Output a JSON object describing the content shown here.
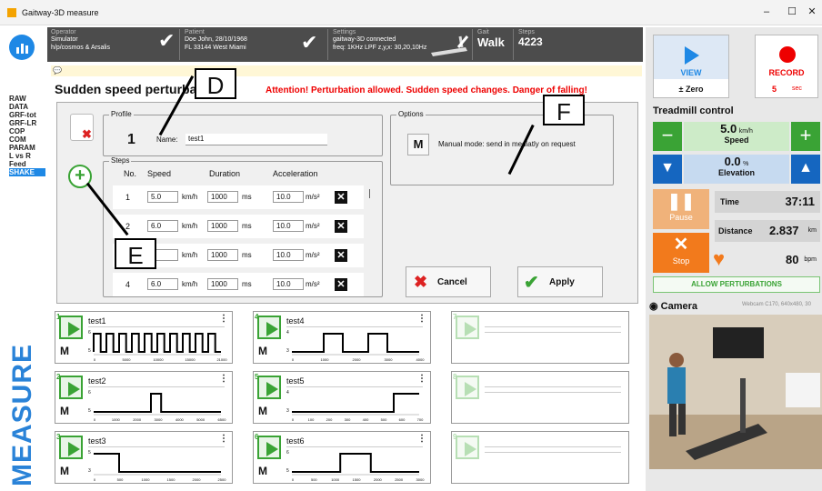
{
  "window": {
    "title": "Gaitway-3D measure",
    "min": "–",
    "max": "☐",
    "close": "✕"
  },
  "infobar": {
    "operator": {
      "label": "Operator",
      "line1": "Simulator",
      "line2": "h/p/cosmos & Arsalis"
    },
    "patient": {
      "label": "Patient",
      "line1": "Doe John, 28/10/1968",
      "line2": "FL 33144 West Miami"
    },
    "settings": {
      "label": "Settings",
      "line1": "gaitway-3D connected",
      "line2": "freq: 1KHz  LPF z,y,x: 30,20,10Hz"
    },
    "gait": {
      "label": "Gait",
      "value": "Walk"
    },
    "steps": {
      "label": "Steps",
      "value": "4223"
    }
  },
  "sidebar": {
    "items": [
      "RAW",
      "DATA",
      "GRF-tot",
      "GRF-LR",
      "COP",
      "COM",
      "PARAM",
      "L vs R",
      "Feed",
      "SHAKE"
    ],
    "selected": "SHAKE",
    "bottom_label": "MEASURE"
  },
  "main": {
    "title": "Sudden speed perturba",
    "attention": "Attention! Perturbation allowed. Sudden speed changes. Danger of falling!",
    "profile": {
      "legend": "Profile",
      "number": "1",
      "name_label": "Name:",
      "name_value": "test1"
    },
    "options": {
      "legend": "Options",
      "m_button": "M",
      "text": "Manual mode: send in mediatly on request"
    },
    "steps": {
      "legend": "Steps",
      "headers": [
        "No.",
        "Speed",
        "Duration",
        "Acceleration"
      ],
      "rows": [
        {
          "no": "1",
          "speed": "5.0",
          "speed_unit": "km/h",
          "duration": "1000",
          "dur_unit": "ms",
          "accel": "10.0",
          "acc_unit": "m/s²"
        },
        {
          "no": "2",
          "speed": "6.0",
          "speed_unit": "km/h",
          "duration": "1000",
          "dur_unit": "ms",
          "accel": "10.0",
          "acc_unit": "m/s²"
        },
        {
          "no": "3",
          "speed": "",
          "speed_unit": "km/h",
          "duration": "1000",
          "dur_unit": "ms",
          "accel": "10.0",
          "acc_unit": "m/s²"
        },
        {
          "no": "4",
          "speed": "6.0",
          "speed_unit": "km/h",
          "duration": "1000",
          "dur_unit": "ms",
          "accel": "10.0",
          "acc_unit": "m/s²"
        }
      ]
    },
    "cancel": "Cancel",
    "apply": "Apply",
    "callouts": {
      "d": "D",
      "e": "E",
      "f": "F"
    }
  },
  "cards": [
    {
      "num": "1",
      "name": "test1",
      "m": "M",
      "ymax": "6",
      "ymin": "5",
      "ticks": [
        "0",
        "5000",
        "10000",
        "15000",
        "21000"
      ],
      "enabled": true
    },
    {
      "num": "4",
      "name": "test4",
      "m": "M",
      "ymax": "4",
      "ymin": "3",
      "ticks": [
        "0",
        "1000",
        "2000",
        "3000",
        "4000"
      ],
      "enabled": true
    },
    {
      "num": "7",
      "name": "",
      "m": "",
      "ymax": "",
      "ymin": "",
      "ticks": [],
      "enabled": false
    },
    {
      "num": "2",
      "name": "test2",
      "m": "M",
      "ymax": "6",
      "ymin": "5",
      "ticks": [
        "0",
        "1000",
        "2000",
        "3000",
        "4000",
        "5000",
        "6500"
      ],
      "enabled": true
    },
    {
      "num": "5",
      "name": "test5",
      "m": "M",
      "ymax": "4",
      "ymin": "3",
      "ticks": [
        "0",
        "100",
        "200",
        "300",
        "400",
        "500",
        "600",
        "700"
      ],
      "enabled": true
    },
    {
      "num": "8",
      "name": "",
      "m": "",
      "ymax": "",
      "ymin": "",
      "ticks": [],
      "enabled": false
    },
    {
      "num": "3",
      "name": "test3",
      "m": "M",
      "ymax": "5",
      "ymin": "3",
      "ticks": [
        "0",
        "500",
        "1000",
        "1500",
        "2000",
        "2500"
      ],
      "enabled": true
    },
    {
      "num": "6",
      "name": "test6",
      "m": "M",
      "ymax": "6",
      "ymin": "5",
      "ticks": [
        "0",
        "500",
        "1000",
        "1500",
        "2000",
        "2500",
        "3000"
      ],
      "enabled": true
    },
    {
      "num": "9",
      "name": "",
      "m": "",
      "ymax": "",
      "ymin": "",
      "ticks": [],
      "enabled": false
    }
  ],
  "right": {
    "view": "VIEW",
    "record": "RECORD",
    "zero": "± Zero",
    "rec_value": "5",
    "rec_unit": "sec",
    "treadmill_title": "Treadmill control",
    "speed_value": "5.0",
    "speed_unit": "km/h",
    "speed_label": "Speed",
    "elev_value": "0.0",
    "elev_unit": "%",
    "elev_label": "Elevation",
    "pause": "Pause",
    "stop": "Stop",
    "time_label": "Time",
    "time_value": "37:11",
    "dist_label": "Distance",
    "dist_value": "2.837",
    "dist_unit": "km",
    "hr_value": "80",
    "hr_unit": "bpm",
    "allow": "ALLOW PERTURBATIONS",
    "camera_label": "Camera",
    "camera_info": "Webcam C170, 640x480, 30"
  },
  "colors": {
    "accent": "#1e88e5",
    "green": "#3aa335",
    "alert": "#e00000",
    "orange": "#f27a1c"
  }
}
